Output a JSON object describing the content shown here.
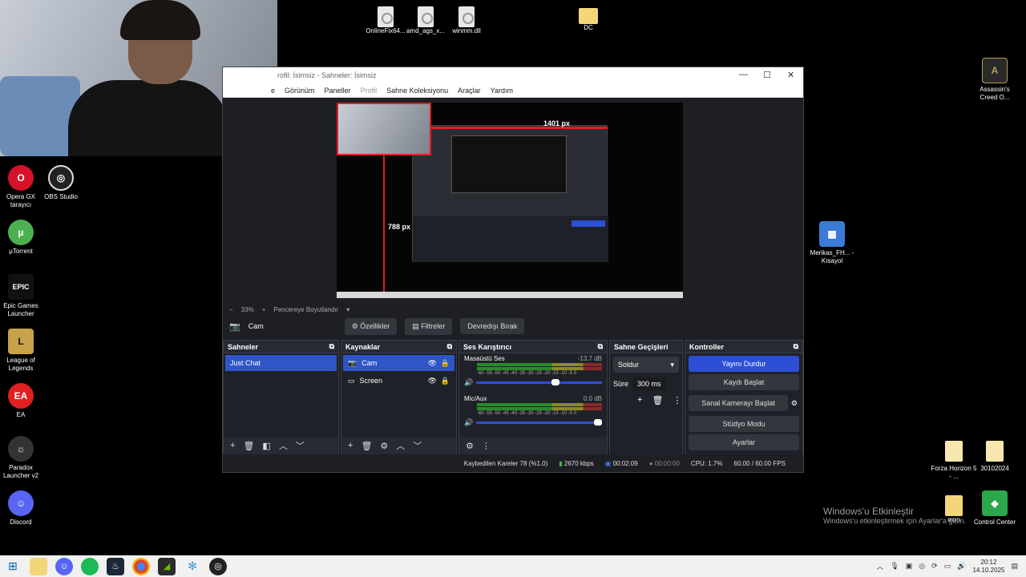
{
  "desktop_top_files": [
    {
      "label": "OnlineFix64...",
      "type": "file"
    },
    {
      "label": "amd_ags_x...",
      "type": "file"
    },
    {
      "label": "winmm.dll",
      "type": "file"
    },
    {
      "label": "DC",
      "type": "folder"
    }
  ],
  "desktop_left_icons": [
    {
      "label": "Opera GX tarayıcı",
      "color": "#d4122a",
      "glyph": "O"
    },
    {
      "label": "OBS Studio",
      "color": "#222",
      "glyph": "◎"
    },
    {
      "label": "µTorrent",
      "color": "#4caf50",
      "glyph": "µ"
    },
    {
      "label": "Epic Games Launcher",
      "color": "#111",
      "glyph": "EPIC"
    },
    {
      "label": "League of Legends",
      "color": "#c8a24a",
      "glyph": "L"
    },
    {
      "label": "EA",
      "color": "#e02020",
      "glyph": "EA"
    },
    {
      "label": "Paradox Launcher v2",
      "color": "#333",
      "glyph": "☼"
    },
    {
      "label": "Discord",
      "color": "#5865f2",
      "glyph": "☺"
    }
  ],
  "desktop_right_icons": [
    {
      "label": "Assassin's Creed O...",
      "color": "#2a2a2a",
      "glyph": "A"
    },
    {
      "label": "Merikas_FH... - Kısayol",
      "color": "#3a7bd5",
      "glyph": "▦"
    },
    {
      "label": "Forza Horizon 5 - ...",
      "type": "folder"
    },
    {
      "label": "30102024",
      "type": "folder"
    },
    {
      "label": "mon",
      "type": "folder"
    },
    {
      "label": "Control Center",
      "color": "#2aa84a",
      "glyph": "◆"
    }
  ],
  "obs": {
    "title": "rofil: İsimsiz - Sahneler: İsimsiz",
    "menu": [
      "e",
      "Görünüm",
      "Paneller",
      "Profil",
      "Sahne Koleksiyonu",
      "Araçlar",
      "Yardım"
    ],
    "preview": {
      "width_label": "1401 px",
      "height_label": "788 px"
    },
    "zoom": {
      "minus": "−",
      "value": "33%",
      "plus": "+",
      "fit": "Pencereye Boyutlandır"
    },
    "source_bar": {
      "source": "Cam",
      "properties": "Özellikler",
      "filters": "Filtreler",
      "deactivate": "Devredışı Bırak"
    },
    "scenes": {
      "title": "Sahneler",
      "items": [
        "Just Chat"
      ]
    },
    "sources": {
      "title": "Kaynaklar",
      "items": [
        "Cam",
        "Screen"
      ]
    },
    "mixer": {
      "title": "Ses Karıştırıcı",
      "channels": [
        {
          "name": "Masaüstü Ses",
          "db": "-13.7 dB",
          "level": 0.62
        },
        {
          "name": "Mic/Aux",
          "db": "0.0 dB",
          "level": 1.0
        }
      ],
      "scale": "-60 -55 -50 -45 -40 -35 -30 -25 -20 -15 -10 -5 0"
    },
    "transitions": {
      "title": "Sahne Geçişleri",
      "selected": "Soldur",
      "duration_label": "Süre",
      "duration": "300 ms"
    },
    "controls": {
      "title": "Kontroller",
      "stop_stream": "Yayını Durdur",
      "start_record": "Kaydı Başlat",
      "virtual_cam": "Sanal Kamerayı Başlat",
      "studio_mode": "Stüdyo Modu",
      "settings": "Ayarlar"
    },
    "status": {
      "dropped": "Kaybedilen Kareler 78 (%1.0)",
      "bitrate": "2670 kbps",
      "stream_time": "00:02:09",
      "rec_time": "00:00:00",
      "cpu": "CPU: 1.7%",
      "fps": "60.00 / 60.00 FPS"
    }
  },
  "watermark": {
    "title": "Windows'u Etkinleştir",
    "subtitle": "Windows'u etkinleştirmek için Ayarlar'a gidin."
  },
  "taskbar": {
    "time": "20:12",
    "date": "14.10.2025"
  }
}
